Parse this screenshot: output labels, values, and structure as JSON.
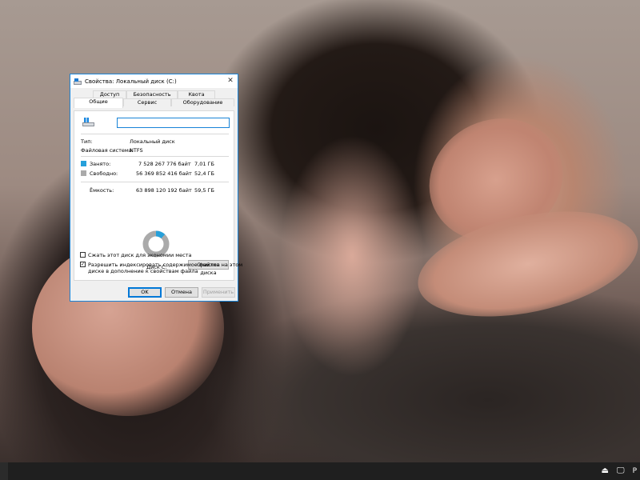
{
  "dialog": {
    "title": "Свойства: Локальный диск (C:)",
    "tabs_row1": [
      "Доступ",
      "Безопасность",
      "Квота"
    ],
    "tabs_row2": [
      "Общие",
      "Сервис",
      "Оборудование"
    ],
    "active_tab": "Общие",
    "drive_name_value": "",
    "type_label": "Тип:",
    "type_value": "Локальный диск",
    "fs_label": "Файловая система:",
    "fs_value": "NTFS",
    "used": {
      "label": "Занято:",
      "bytes": "7 528 267 776 байт",
      "size": "7,01 ГБ",
      "color": "#26a0da"
    },
    "free": {
      "label": "Свободно:",
      "bytes": "56 369 852 416 байт",
      "size": "52,4 ГБ",
      "color": "#aaaaaa"
    },
    "capacity": {
      "label": "Ёмкость:",
      "bytes": "63 898 120 192 байт",
      "size": "59,5 ГБ"
    },
    "used_fraction": 0.118,
    "disk_label": "Диск C:",
    "cleanup_button": "Очистка диска",
    "compress_label": "Сжать этот диск для экономии места",
    "compress_checked": false,
    "index_label_line1": "Разрешить индексировать содержимое файлов на этом",
    "index_label_line2": "диске в дополнение к свойствам файла",
    "index_checked": true,
    "ok_button": "OK",
    "cancel_button": "Отмена",
    "apply_button": "Применить",
    "accent": "#1883d7"
  },
  "taskbar": {
    "lang": "Р",
    "tray_icons": [
      "usb-icon",
      "network-icon"
    ]
  }
}
